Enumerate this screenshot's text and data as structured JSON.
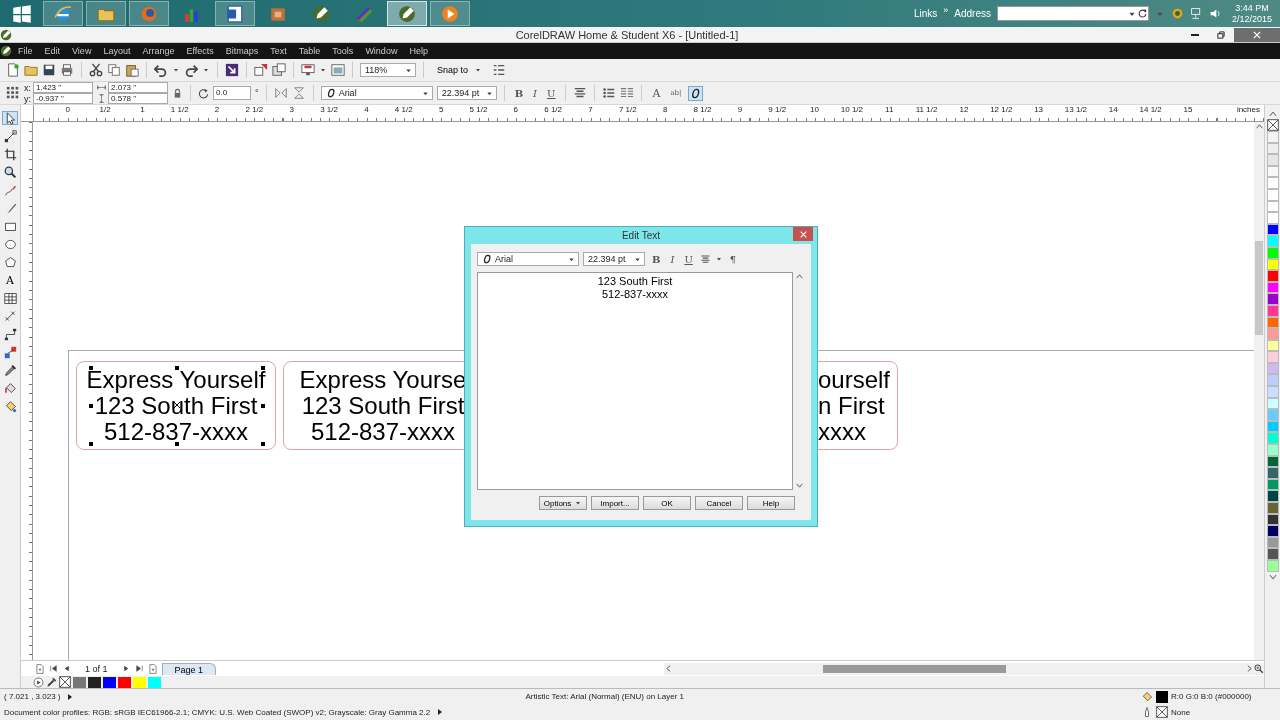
{
  "taskbar": {
    "apps": [
      {
        "kind": "browser",
        "running": true,
        "selected": false
      },
      {
        "kind": "folder",
        "running": true,
        "selected": false
      },
      {
        "kind": "firefox",
        "running": true,
        "selected": false
      },
      {
        "kind": "chart",
        "running": false,
        "selected": false
      },
      {
        "kind": "document",
        "running": true,
        "selected": false
      },
      {
        "kind": "box",
        "running": false,
        "selected": false
      },
      {
        "kind": "pen",
        "running": false,
        "selected": false
      },
      {
        "kind": "rainbow",
        "running": false,
        "selected": false
      },
      {
        "kind": "pen",
        "running": true,
        "selected": true
      },
      {
        "kind": "media",
        "running": true,
        "selected": false
      }
    ],
    "links": "Links",
    "chevron": "»",
    "address_label": "Address",
    "time": "3:44 PM",
    "date": "2/12/2015"
  },
  "window": {
    "title": "CorelDRAW Home & Student X6 - [Untitled-1]"
  },
  "menu": [
    "File",
    "Edit",
    "View",
    "Layout",
    "Arrange",
    "Effects",
    "Bitmaps",
    "Text",
    "Table",
    "Tools",
    "Window",
    "Help"
  ],
  "toolbar": {
    "zoom": "118%",
    "snap": "Snap to"
  },
  "property_bar": {
    "x_label": "x:",
    "x": "1.423 \"",
    "y_label": "y:",
    "y": "-0.937 \"",
    "width": "2.073 \"",
    "height": "0.578 \"",
    "rotation": "0.0",
    "degree": "°",
    "font": "Arial",
    "size": "22.394 pt",
    "format_buttons": [
      "B",
      "I",
      "U"
    ],
    "text_tools": [
      "A",
      "ab|"
    ],
    "font_list_active": true
  },
  "ruler": {
    "labels": [
      "0",
      "1/2",
      "1",
      "1 1/2",
      "2",
      "2 1/2",
      "3",
      "3 1/2",
      "4",
      "4 1/2",
      "5",
      "5 1/2",
      "6",
      "6 1/2",
      "7",
      "7 1/2",
      "8",
      "8 1/2",
      "9",
      "9 1/2",
      "10",
      "10 1/2",
      "11",
      "11 1/2",
      "12",
      "12 1/2",
      "13",
      "13 1/2",
      "14",
      "14 1/2",
      "15"
    ],
    "unit": "inches"
  },
  "toolbox": [
    {
      "kind": "pointer",
      "selected": true
    },
    {
      "kind": "shape",
      "selected": false
    },
    {
      "kind": "crop",
      "selected": false
    },
    {
      "kind": "zoom",
      "selected": false
    },
    {
      "kind": "freehand",
      "selected": false
    },
    {
      "kind": "media",
      "selected": false
    },
    {
      "kind": "rectangle",
      "selected": false
    },
    {
      "kind": "ellipse",
      "selected": false
    },
    {
      "kind": "polygon",
      "selected": false
    },
    {
      "kind": "text",
      "glyph": "A",
      "selected": false
    },
    {
      "kind": "table",
      "selected": false
    },
    {
      "kind": "dimension",
      "selected": false
    },
    {
      "kind": "connector",
      "selected": false
    },
    {
      "kind": "blend",
      "selected": false
    },
    {
      "kind": "eyedropper",
      "selected": false
    },
    {
      "kind": "fill",
      "selected": false
    },
    {
      "kind": "smartfill",
      "selected": false
    }
  ],
  "canvas": {
    "cards": [
      {
        "lines": [
          "Express Yourself",
          "123 South First",
          "512-837-xxxx"
        ],
        "selected": true
      },
      {
        "lines": [
          "Express Yourse",
          "123 South First",
          "512-837-xxxx"
        ],
        "selected": false
      },
      {
        "lines": [
          "ourself",
          "n First",
          "xxxx"
        ],
        "selected": false
      }
    ]
  },
  "dialog": {
    "title": "Edit Text",
    "font": "Arial",
    "size": "22.394 pt",
    "format_buttons": [
      "B",
      "I",
      "U"
    ],
    "paragraph_mark": "¶",
    "text_lines": [
      "123 South First",
      "512-837-xxxx"
    ],
    "buttons": [
      {
        "label": "Options",
        "menu": true
      },
      {
        "label": "Import...",
        "menu": false
      },
      {
        "label": "OK",
        "menu": false
      },
      {
        "label": "Cancel",
        "menu": false
      },
      {
        "label": "Help",
        "menu": false
      }
    ]
  },
  "page_nav": {
    "counter": "1 of 1",
    "page_tab": "Page 1"
  },
  "bottom_palette": [
    {
      "kind": "none"
    },
    {
      "kind": "swatch",
      "color": "#777777"
    },
    {
      "kind": "swatch",
      "color": "#222222"
    },
    {
      "kind": "swatch",
      "color": "#0000ff"
    },
    {
      "kind": "swatch",
      "color": "#ff0000"
    },
    {
      "kind": "swatch",
      "color": "#ffff00"
    },
    {
      "kind": "swatch",
      "color": "#00ffff"
    }
  ],
  "right_palette": [
    {
      "kind": "none"
    },
    {
      "kind": "swatch",
      "color": "#f4f4f4"
    },
    {
      "kind": "swatch",
      "color": "#eeeeee"
    },
    {
      "kind": "swatch",
      "color": "#e6e6e6"
    },
    {
      "kind": "swatch",
      "color": "#f8f8f8"
    },
    {
      "kind": "swatch",
      "color": "#ffffff"
    },
    {
      "kind": "swatch",
      "color": "#ffffff"
    },
    {
      "kind": "swatch",
      "color": "#ffffff"
    },
    {
      "kind": "swatch",
      "color": "#ffffff"
    },
    {
      "kind": "swatch",
      "color": "#0000ff"
    },
    {
      "kind": "swatch",
      "color": "#00ffff"
    },
    {
      "kind": "swatch",
      "color": "#00ff00"
    },
    {
      "kind": "swatch",
      "color": "#ffff00"
    },
    {
      "kind": "swatch",
      "color": "#ff0000"
    },
    {
      "kind": "swatch",
      "color": "#ff00ff"
    },
    {
      "kind": "swatch",
      "color": "#9900cc"
    },
    {
      "kind": "swatch",
      "color": "#ff3399"
    },
    {
      "kind": "swatch",
      "color": "#ff6600"
    },
    {
      "kind": "swatch",
      "color": "#ff9999"
    },
    {
      "kind": "swatch",
      "color": "#ffff99"
    },
    {
      "kind": "swatch",
      "color": "#ffccdd"
    },
    {
      "kind": "swatch",
      "color": "#ccbbee"
    },
    {
      "kind": "swatch",
      "color": "#bbccff"
    },
    {
      "kind": "swatch",
      "color": "#ccddff"
    },
    {
      "kind": "swatch",
      "color": "#ccffff"
    },
    {
      "kind": "swatch",
      "color": "#66ccff"
    },
    {
      "kind": "swatch",
      "color": "#00ccff"
    },
    {
      "kind": "swatch",
      "color": "#00ffcc"
    },
    {
      "kind": "swatch",
      "color": "#99ffcc"
    },
    {
      "kind": "swatch",
      "color": "#006633"
    },
    {
      "kind": "swatch",
      "color": "#336666"
    },
    {
      "kind": "swatch",
      "color": "#009966"
    },
    {
      "kind": "swatch",
      "color": "#004444"
    },
    {
      "kind": "swatch",
      "color": "#666633"
    },
    {
      "kind": "swatch",
      "color": "#333333"
    },
    {
      "kind": "swatch",
      "color": "#000066"
    },
    {
      "kind": "swatch",
      "color": "#999999"
    },
    {
      "kind": "swatch",
      "color": "#555555"
    },
    {
      "kind": "swatch",
      "color": "#99ff99"
    }
  ],
  "status": {
    "coords": "( 7.021 , 3.023 )",
    "object": "Artistic Text: Arial (Normal) (ENU) on Layer 1",
    "fill": "R:0 G:0 B:0 (#000000)",
    "outline": "None",
    "profiles": "Document color profiles: RGB: sRGB IEC61966-2.1; CMYK: U.S. Web Coated (SWOP) v2; Grayscale: Gray Gamma 2.2"
  }
}
